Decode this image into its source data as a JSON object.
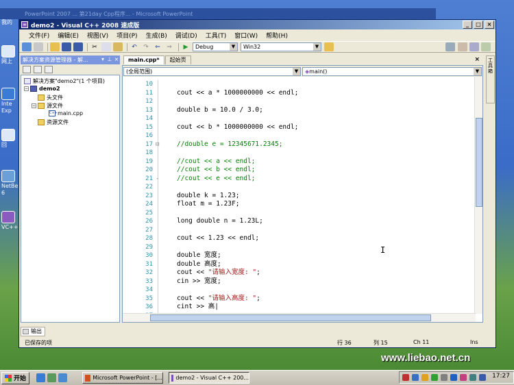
{
  "desktop": {
    "background_title": "PowerPoint 2007 ... 第21day Cpp程序... - Microsoft PowerPoint",
    "icons": [
      {
        "label": "我的",
        "icon": "computer-icon"
      },
      {
        "label": "网上",
        "icon": "network-icon"
      },
      {
        "label": "Inte Exp",
        "icon": "ie-icon"
      },
      {
        "label": "回",
        "icon": "recycle-icon"
      },
      {
        "label": "NetBe 6",
        "icon": "netbeans-icon"
      },
      {
        "label": "VC++ ",
        "icon": "vc-icon"
      }
    ]
  },
  "window": {
    "title": "demo2 - Visual C++ 2008 速成版",
    "controls": {
      "minimize": "_",
      "maximize": "□",
      "close": "×"
    }
  },
  "menu": [
    "文件(F)",
    "编辑(E)",
    "视图(V)",
    "项目(P)",
    "生成(B)",
    "调试(D)",
    "工具(T)",
    "窗口(W)",
    "帮助(H)"
  ],
  "toolbar": {
    "config": "Debug",
    "platform": "Win32"
  },
  "solution_explorer": {
    "title": "解决方案资源管理器 - 解...",
    "items": [
      {
        "label": "解决方案\"demo2\"(1 个项目)",
        "type": "solution",
        "level": 0
      },
      {
        "label": "demo2",
        "type": "project",
        "level": 0,
        "bold": true
      },
      {
        "label": "头文件",
        "type": "folder",
        "level": 1
      },
      {
        "label": "源文件",
        "type": "folder",
        "level": 1
      },
      {
        "label": "main.cpp",
        "type": "cpp",
        "level": 2
      },
      {
        "label": "资源文件",
        "type": "folder",
        "level": 1
      }
    ]
  },
  "editor": {
    "tabs": [
      {
        "label": "main.cpp*",
        "active": true
      },
      {
        "label": "起始页",
        "active": false
      }
    ],
    "close_tab": "×",
    "scope_left": "(全局范围)",
    "scope_right": "main()",
    "lines": [
      {
        "n": "10",
        "text": ""
      },
      {
        "n": "11",
        "text": "cout << a * 1000000000 << endl;"
      },
      {
        "n": "12",
        "text": ""
      },
      {
        "n": "13",
        "text": "double b = 10.0 / 3.0;"
      },
      {
        "n": "14",
        "text": ""
      },
      {
        "n": "15",
        "text": "cout << b * 1000000000 << endl;"
      },
      {
        "n": "16",
        "text": ""
      },
      {
        "n": "17",
        "text": "//double e = 12345671.2345;",
        "comment": true,
        "fold": "⊟"
      },
      {
        "n": "18",
        "text": ""
      },
      {
        "n": "19",
        "text": "//cout << a << endl;",
        "comment": true
      },
      {
        "n": "20",
        "text": "//cout << b << endl;",
        "comment": true
      },
      {
        "n": "21",
        "text": "//cout << e << endl;",
        "comment": true,
        "fold": "-"
      },
      {
        "n": "22",
        "text": ""
      },
      {
        "n": "23",
        "text": "double k = 1.23;"
      },
      {
        "n": "24",
        "text": "float m = 1.23F;"
      },
      {
        "n": "25",
        "text": ""
      },
      {
        "n": "26",
        "text": "long double n = 1.23L;"
      },
      {
        "n": "27",
        "text": ""
      },
      {
        "n": "28",
        "text": "cout << 1.23 << endl;"
      },
      {
        "n": "29",
        "text": ""
      },
      {
        "n": "30",
        "text": "double 宽度;"
      },
      {
        "n": "31",
        "text": "double 高度;"
      },
      {
        "n": "32",
        "text": "cout << \"请输入宽度: \";",
        "string": true
      },
      {
        "n": "33",
        "text": "cin >> 宽度;"
      },
      {
        "n": "34",
        "text": ""
      },
      {
        "n": "35",
        "text": "cout << \"请输入高度: \";",
        "string": true
      },
      {
        "n": "36",
        "text": "cint >> 高|"
      },
      {
        "n": "37",
        "text": ""
      }
    ]
  },
  "right_sidebar": "工具箱",
  "output_tab": "输出",
  "status": {
    "message": "已保存的项",
    "row": "行 36",
    "col": "列 15",
    "ch": "Ch 11",
    "mode": "Ins"
  },
  "watermark": "www.liebao.net.cn",
  "taskbar": {
    "start": "开始",
    "tasks": [
      {
        "label": "Microsoft PowerPoint - [...",
        "active": false
      },
      {
        "label": "demo2 - Visual C++ 200...",
        "active": true
      }
    ],
    "clock": "17:27"
  },
  "colors": {
    "titlebar": "#0a246a",
    "line_numbers": "#2b91af",
    "comment": "#008000",
    "string": "#a31515"
  }
}
